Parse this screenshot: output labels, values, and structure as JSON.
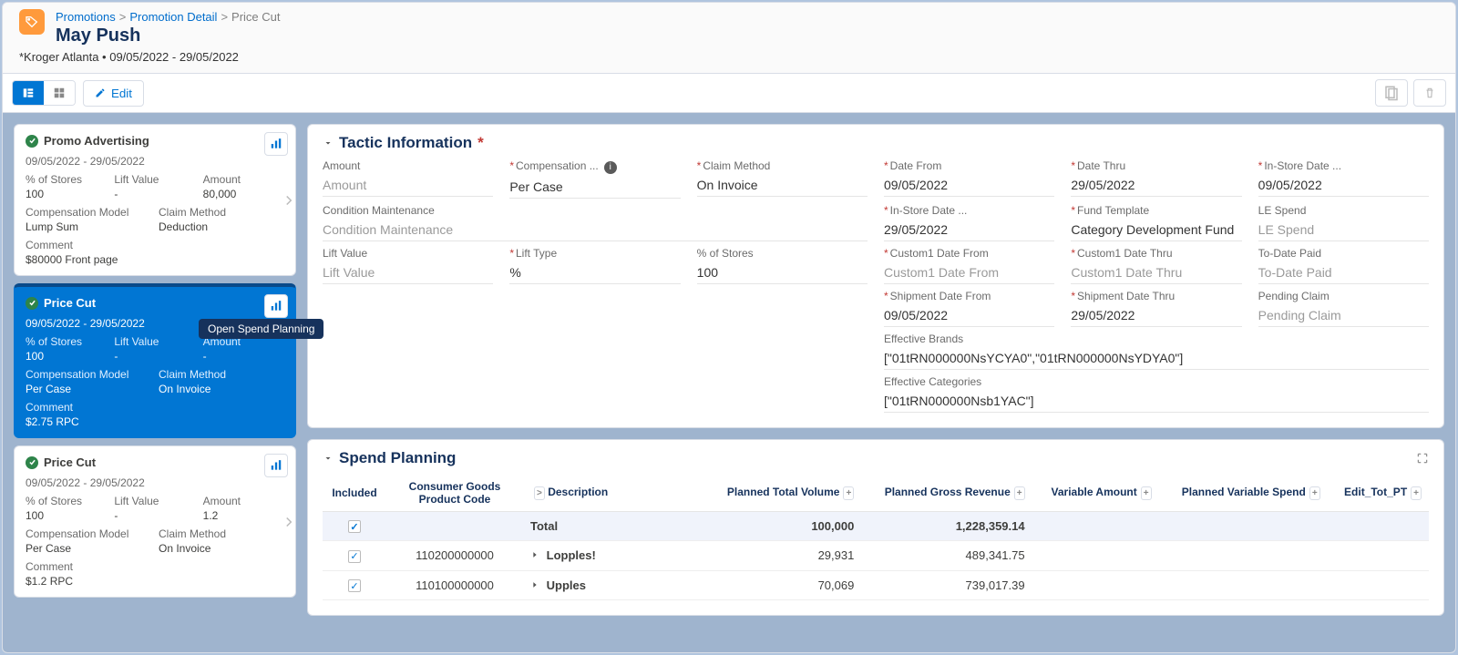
{
  "breadcrumbs": {
    "root": "Promotions",
    "mid": "Promotion Detail",
    "cur": "Price Cut"
  },
  "page": {
    "title": "May Push",
    "subtitle": "*Kroger Atlanta • 09/05/2022 - 29/05/2022"
  },
  "toolbar": {
    "edit": "Edit"
  },
  "tooltip": {
    "open_spend_planning": "Open Spend Planning"
  },
  "tactics": [
    {
      "id": "t1",
      "name": "Promo Advertising",
      "dates": "09/05/2022 - 29/05/2022",
      "stores": "100",
      "lift": "-",
      "amount": "80,000",
      "comp_model": "Lump Sum",
      "claim": "Deduction",
      "comment": "$80000 Front page"
    },
    {
      "id": "t2",
      "name": "Price Cut",
      "dates": "09/05/2022 - 29/05/2022",
      "stores": "100",
      "lift": "-",
      "amount": "-",
      "comp_model": "Per Case",
      "claim": "On Invoice",
      "comment": "$2.75 RPC"
    },
    {
      "id": "t3",
      "name": "Price Cut",
      "dates": "09/05/2022 - 29/05/2022",
      "stores": "100",
      "lift": "-",
      "amount": "1.2",
      "comp_model": "Per Case",
      "claim": "On Invoice",
      "comment": "$1.2 RPC"
    }
  ],
  "fl": {
    "pct_stores": "% of Stores",
    "lift_value": "Lift Value",
    "amount": "Amount",
    "comp_model": "Compensation Model",
    "claim": "Claim Method",
    "comment": "Comment"
  },
  "sections": {
    "tactic_info": "Tactic Information",
    "spend_planning": "Spend Planning"
  },
  "fields": {
    "amount_lbl": "Amount",
    "amount_val": "Amount",
    "comp_lbl": "Compensation ...",
    "comp_val": "Per Case",
    "claim_lbl": "Claim Method",
    "claim_val": "On Invoice",
    "date_from_lbl": "Date From",
    "date_from": "09/05/2022",
    "date_thru_lbl": "Date Thru",
    "date_thru": "29/05/2022",
    "in_from_lbl": "In-Store Date ...",
    "in_from": "09/05/2022",
    "in_thru_lbl": "In-Store Date ...",
    "in_thru": "29/05/2022",
    "fund_lbl": "Fund Template",
    "fund_val": "Category Development Fund",
    "le_lbl": "LE Spend",
    "le_ph": "LE Spend",
    "cond_lbl": "Condition Maintenance",
    "cond_val": "Condition Maintenance",
    "c1from_lbl": "Custom1 Date From",
    "c1from_ph": "Custom1 Date From",
    "c1thru_lbl": "Custom1 Date Thru",
    "c1thru_ph": "Custom1 Date Thru",
    "todate_lbl": "To-Date Paid",
    "todate_ph": "To-Date Paid",
    "pending_lbl": "Pending Claim",
    "pending_ph": "Pending Claim",
    "liftval_lbl": "Lift Value",
    "liftval_ph": "Lift Value",
    "lifttype_lbl": "Lift Type",
    "lifttype_val": "%",
    "pct_lbl": "% of Stores",
    "pct_val": "100",
    "shipfrom_lbl": "Shipment Date From",
    "shipfrom": "09/05/2022",
    "shipthru_lbl": "Shipment Date Thru",
    "shipthru": "29/05/2022",
    "brands_lbl": "Effective Brands",
    "brands_val": "[\"01tRN000000NsYCYA0\",\"01tRN000000NsYDYA0\"]",
    "cats_lbl": "Effective Categories",
    "cats_val": "[\"01tRN000000Nsb1YAC\"]"
  },
  "spend": {
    "cols": {
      "included": "Included",
      "code": "Consumer Goods Product Code",
      "desc": "Description",
      "ptv": "Planned Total Volume",
      "pgr": "Planned Gross Revenue",
      "va": "Variable Amount",
      "pvs": "Planned Variable Spend",
      "ett": "Edit_Tot_PT"
    },
    "rows": [
      {
        "included": true,
        "code": "",
        "desc": "Total",
        "ptv": "100,000",
        "pgr": "1,228,359.14",
        "total": true
      },
      {
        "included": true,
        "code": "110200000000",
        "desc": "Lopples!",
        "ptv": "29,931",
        "pgr": "489,341.75"
      },
      {
        "included": true,
        "code": "110100000000",
        "desc": "Upples",
        "ptv": "70,069",
        "pgr": "739,017.39"
      }
    ]
  }
}
